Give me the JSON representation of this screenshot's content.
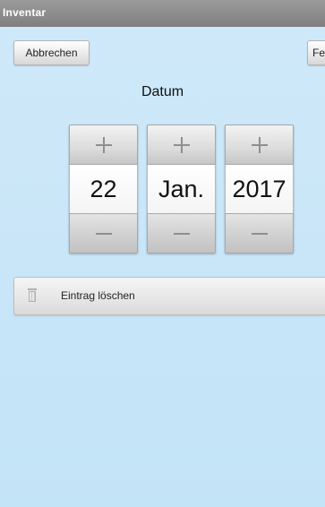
{
  "window": {
    "title": "Inventar"
  },
  "toolbar": {
    "cancel_label": "Abbrechen",
    "right_label": "Fe"
  },
  "date_picker": {
    "label": "Datum",
    "day": "22",
    "month": "Jan.",
    "year": "2017"
  },
  "actions": {
    "delete_label": "Eintrag löschen"
  },
  "colors": {
    "titlebar": "#8a8a8a",
    "background": "#c8e6f8"
  }
}
